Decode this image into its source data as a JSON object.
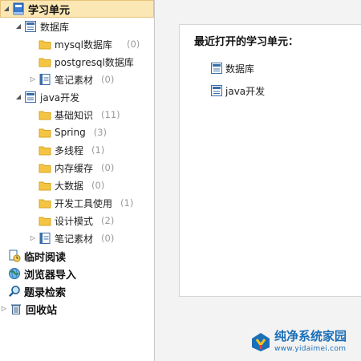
{
  "tree": {
    "root": {
      "label": "学习单元",
      "icon": "book-icon"
    },
    "database": {
      "label": "数据库",
      "icon": "notebook-icon",
      "children": [
        {
          "label": "mysql数据库",
          "count": "(0)"
        },
        {
          "label": "postgresql数据库",
          "count": ""
        },
        {
          "label": "笔记素材",
          "count": "(0)",
          "collapsed": true
        }
      ]
    },
    "java": {
      "label": "java开发",
      "icon": "notebook-icon",
      "children": [
        {
          "label": "基础知识",
          "count": "(11)"
        },
        {
          "label": "Spring",
          "count": "(3)"
        },
        {
          "label": "多线程",
          "count": "(1)"
        },
        {
          "label": "内存缓存",
          "count": "(0)"
        },
        {
          "label": "大数据",
          "count": "(0)"
        },
        {
          "label": "开发工具使用",
          "count": "(1)"
        },
        {
          "label": "设计模式",
          "count": "(2)"
        },
        {
          "label": "笔记素材",
          "count": "(0)",
          "collapsed": true
        }
      ]
    },
    "bottom": [
      {
        "label": "临时阅读",
        "icon": "clock-doc-icon"
      },
      {
        "label": "浏览器导入",
        "icon": "globe-icon"
      },
      {
        "label": "题录检索",
        "icon": "magnifier-icon"
      },
      {
        "label": "回收站",
        "icon": "trash-icon"
      }
    ]
  },
  "recent_panel": {
    "title": "最近打开的学习单元：",
    "items": [
      {
        "label": "数据库"
      },
      {
        "label": "java开发"
      }
    ]
  },
  "watermark": {
    "name": "纯净系统家园",
    "url": "www.yidaimei.com"
  },
  "colors": {
    "selected_bg": "#fbe7b4",
    "folder": "#f4c542",
    "watermark": "#1b6fb8"
  }
}
